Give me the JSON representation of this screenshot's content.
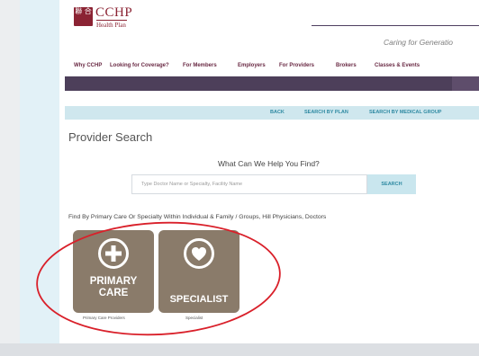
{
  "header": {
    "logo_glyphs": "聯\n合",
    "brand_name": "CCHP",
    "brand_sub": "Health Plan",
    "tagline": "Caring for Generatio"
  },
  "nav": {
    "items": [
      {
        "label": "Why CCHP"
      },
      {
        "label": "Looking for Coverage?"
      },
      {
        "label": "For Members"
      },
      {
        "label": "Employers"
      },
      {
        "label": "For Providers"
      },
      {
        "label": "Brokers"
      },
      {
        "label": "Classes & Events"
      }
    ]
  },
  "subnav": {
    "back": "BACK",
    "by_plan": "SEARCH BY PLAN",
    "by_group": "SEARCH BY MEDICAL GROUP"
  },
  "page_title": "Provider Search",
  "search": {
    "heading": "What Can We Help You Find?",
    "placeholder": "Type Doctor Name or Specialty, Facility Name",
    "button": "SEARCH"
  },
  "find_by": "Find By Primary Care Or Specialty Within Individual & Family / Groups, Hill Physicians, Doctors",
  "tiles": [
    {
      "line1": "PRIMARY",
      "line2": "CARE",
      "caption": "Primary Care Providers",
      "icon": "plus-icon"
    },
    {
      "line1": "SPECIALIST",
      "caption": "Specialist",
      "icon": "heart-icon"
    }
  ],
  "colors": {
    "brand": "#8b2333",
    "nav_bar": "#4d3f5a",
    "accent": "#2f8aa2",
    "tile": "#8a7b6a",
    "annotation": "#d9202a"
  }
}
